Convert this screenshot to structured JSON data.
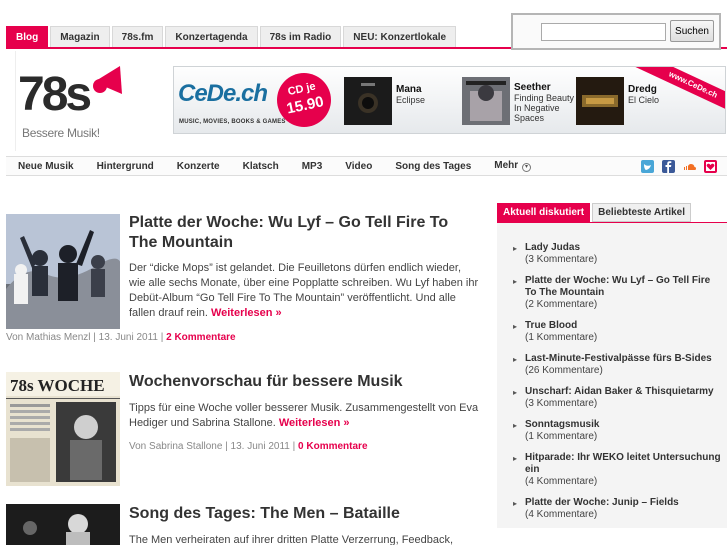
{
  "topnav": {
    "tabs": [
      {
        "label": "Blog",
        "active": true
      },
      {
        "label": "Magazin",
        "active": false
      },
      {
        "label": "78s.fm",
        "active": false
      },
      {
        "label": "Konzertagenda",
        "active": false
      },
      {
        "label": "78s im Radio",
        "active": false
      },
      {
        "label": "NEU: Konzertlokale",
        "active": false
      }
    ]
  },
  "search": {
    "value": "",
    "placeholder": "",
    "button_label": "Suchen"
  },
  "logo": {
    "mark": "78s",
    "tagline": "Bessere Musik!"
  },
  "banner": {
    "brand": "CeDe.ch",
    "subline": "MUSIC, MOVIES, BOOKS & GAMES",
    "badge_line1": "CD je",
    "badge_line2": "15.90",
    "ribbon": "www.CeDe.ch",
    "albums": [
      {
        "artist": "Mana",
        "title": "Eclipse"
      },
      {
        "artist": "Seether",
        "title": "Finding Beauty In Negative Spaces"
      },
      {
        "artist": "Dredg",
        "title": "El Cielo"
      }
    ]
  },
  "subnav": {
    "items": [
      "Neue Musik",
      "Hintergrund",
      "Konzerte",
      "Klatsch",
      "MP3",
      "Video",
      "Song des Tages",
      "Mehr"
    ]
  },
  "articles": [
    {
      "title": "Platte der Woche: Wu Lyf – Go Tell Fire To The Mountain",
      "body": "Der “dicke Mops” ist gelandet. Die Feuilletons dürfen endlich wieder, wie alle sechs Monate, über eine Popplatte schreiben. Wu Lyf haben ihr Debüt-Album “Go Tell Fire To The Mountain” veröffentlicht. Und alle fallen drauf rein.",
      "more": "Weiterlesen »",
      "meta": "Von Mathias Menzl | 13. Juni 2011 | ",
      "comments": "2 Kommentare"
    },
    {
      "title": "Wochenvorschau für bessere Musik",
      "body": "Tipps für eine Woche voller besserer Musik. Zusammengestellt von Eva Hediger und Sabrina Stallone.",
      "more": "Weiterlesen »",
      "meta": "Von Sabrina Stallone | 13. Juni 2011 | ",
      "comments": "0 Kommentare",
      "thumb_text": "78s WOCHE"
    },
    {
      "title": "Song des Tages: The Men – Bataille",
      "body": "The Men verheiraten auf ihrer dritten Platte Verzerrung, Feedback,"
    }
  ],
  "sidebar": {
    "tabs": [
      {
        "label": "Aktuell diskutiert",
        "active": true
      },
      {
        "label": "Beliebteste Artikel",
        "active": false
      }
    ],
    "items": [
      {
        "title": "Lady Judas",
        "count": "(3 Kommentare)"
      },
      {
        "title": "Platte der Woche: Wu Lyf – Go Tell Fire To The Mountain",
        "count": "(2 Kommentare)"
      },
      {
        "title": "True Blood",
        "count": "(1 Kommentare)"
      },
      {
        "title": "Last-Minute-Festivalpässe fürs B-Sides",
        "count": "(26 Kommentare)"
      },
      {
        "title": "Unscharf: Aidan Baker & Thisquietarmy",
        "count": "(3 Kommentare)"
      },
      {
        "title": "Sonntagsmusik",
        "count": "(1 Kommentare)"
      },
      {
        "title": "Hitparade: Ihr WEKO leitet Untersuchung ein",
        "count": "(4 Kommentare)"
      },
      {
        "title": "Platte der Woche: Junip – Fields",
        "count": "(4 Kommentare)"
      }
    ]
  },
  "colors": {
    "accent": "#e6004c",
    "cede_blue": "#1a6fa0"
  }
}
